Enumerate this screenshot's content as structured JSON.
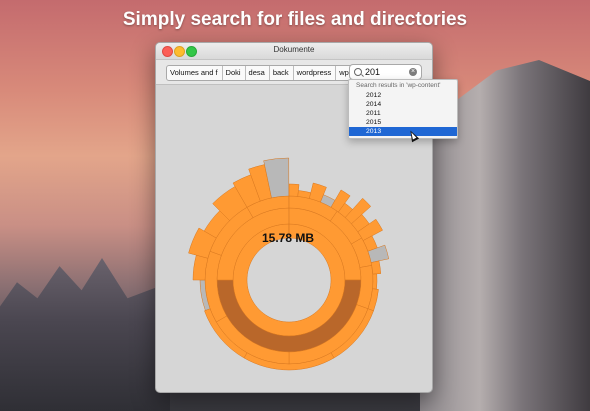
{
  "headline": "Simply search for files and directories",
  "window": {
    "title": "Dokumente",
    "breadcrumb": [
      "Volumes and f",
      "Doki",
      "desa",
      "back",
      "wordpress",
      "wp-content"
    ],
    "search": {
      "value": "201",
      "header": "Search results in 'wp-content'",
      "results": [
        "2012",
        "2014",
        "2011",
        "2015",
        "2013"
      ],
      "selected_index": 4
    },
    "center_label": "15.78 MB"
  },
  "colors": {
    "segment_fill": "#ff9a33",
    "segment_border": "#d9781f",
    "dark_ring": "#b9672a",
    "free_space": "#b8b8b8",
    "selection": "#1f67d4"
  },
  "icons": {
    "search": "magnifier",
    "clear": "x-circle"
  }
}
